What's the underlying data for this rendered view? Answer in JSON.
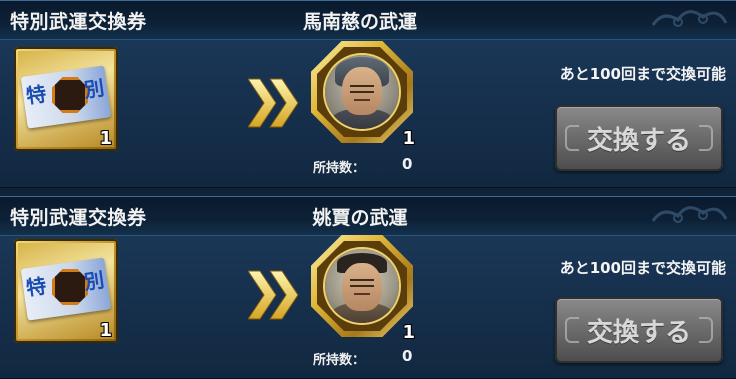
{
  "rows": [
    {
      "ticket_title": "特別武運交換券",
      "ticket_char_left": "特",
      "ticket_char_right": "別",
      "ticket_qty": "1",
      "fortune_title": "馬南慈の武運",
      "reward_qty": "1",
      "owned_label": "所持数：",
      "owned_value": "0",
      "remaining_text": "あと100回まで交換可能",
      "exchange_label": "交換する",
      "portrait": "helmeted-general-portrait"
    },
    {
      "ticket_title": "特別武運交換券",
      "ticket_char_left": "特",
      "ticket_char_right": "別",
      "ticket_qty": "1",
      "fortune_title": "姚賈の武運",
      "reward_qty": "1",
      "owned_label": "所持数：",
      "owned_value": "0",
      "remaining_text": "あと100回まで交換可能",
      "exchange_label": "交換する",
      "portrait": "mustached-noble-portrait"
    }
  ],
  "colors": {
    "panel_bg": "#1d3c5d",
    "header_bg": "#0a1a2e",
    "gold": "#e0b83a",
    "button_disabled": "#6b6b6b",
    "arrow_gold": "#f2d674"
  },
  "icons": [
    "ticket-icon",
    "double-chevron-icon",
    "octagon-medal-icon"
  ]
}
